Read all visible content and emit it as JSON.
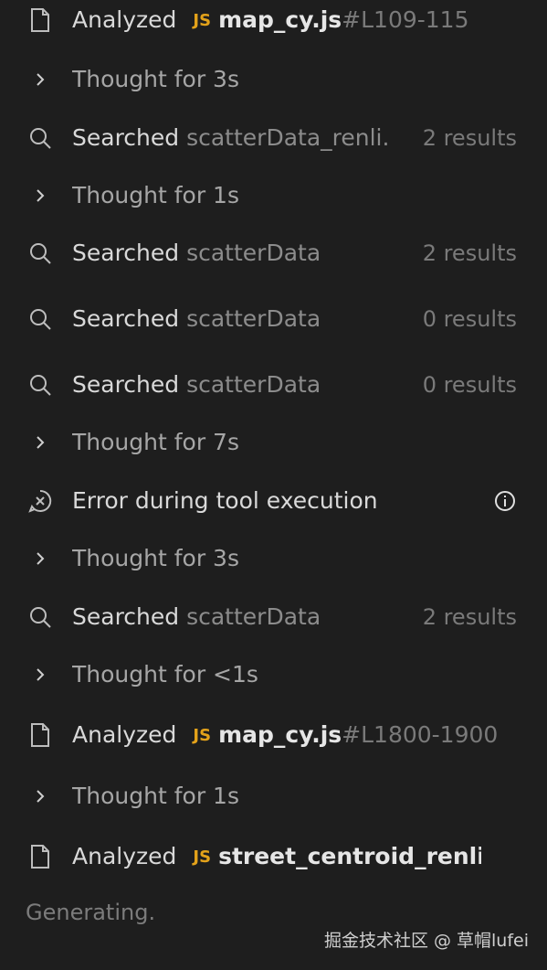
{
  "steps": [
    {
      "verb": "Analyzed",
      "lang": "JS",
      "file": "map_cy.js",
      "lines": "#L109-115",
      "icon": "file-icon"
    },
    {
      "thought": "Thought for 3s",
      "icon": "chevron-right-icon"
    },
    {
      "verb": "Searched",
      "arg": "scatterData_renli...",
      "count": "2 results",
      "icon": "search-icon"
    },
    {
      "thought": "Thought for 1s",
      "icon": "chevron-right-icon"
    },
    {
      "verb": "Searched",
      "arg": "scatterData",
      "count": "2 results",
      "icon": "search-icon"
    },
    {
      "verb": "Searched",
      "arg": "scatterData",
      "count": "0 results",
      "icon": "search-icon"
    },
    {
      "verb": "Searched",
      "arg": "scatterData",
      "count": "0 results",
      "icon": "search-icon"
    },
    {
      "thought": "Thought for 7s",
      "icon": "chevron-right-icon"
    },
    {
      "error": "Error during tool execution",
      "icon": "error-circle-icon",
      "trailing_icon": "info-icon"
    },
    {
      "thought": "Thought for 3s",
      "icon": "chevron-right-icon"
    },
    {
      "verb": "Searched",
      "arg": "scatterData",
      "count": "2 results",
      "icon": "search-icon"
    },
    {
      "thought": "Thought for <1s",
      "icon": "chevron-right-icon"
    },
    {
      "verb": "Analyzed",
      "lang": "JS",
      "file": "map_cy.js",
      "lines": "#L1800-1900",
      "icon": "file-icon"
    },
    {
      "thought": "Thought for 1s",
      "icon": "chevron-right-icon"
    },
    {
      "verb": "Analyzed",
      "lang": "JS",
      "file": "street_centroid_renliziyu",
      "icon": "file-icon"
    }
  ],
  "status": {
    "generating": "Generating."
  },
  "watermark": "掘金技术社区 @ 草帽lufei",
  "colors": {
    "background": "#1e1e1e",
    "js_badge": "#e3a21a"
  }
}
